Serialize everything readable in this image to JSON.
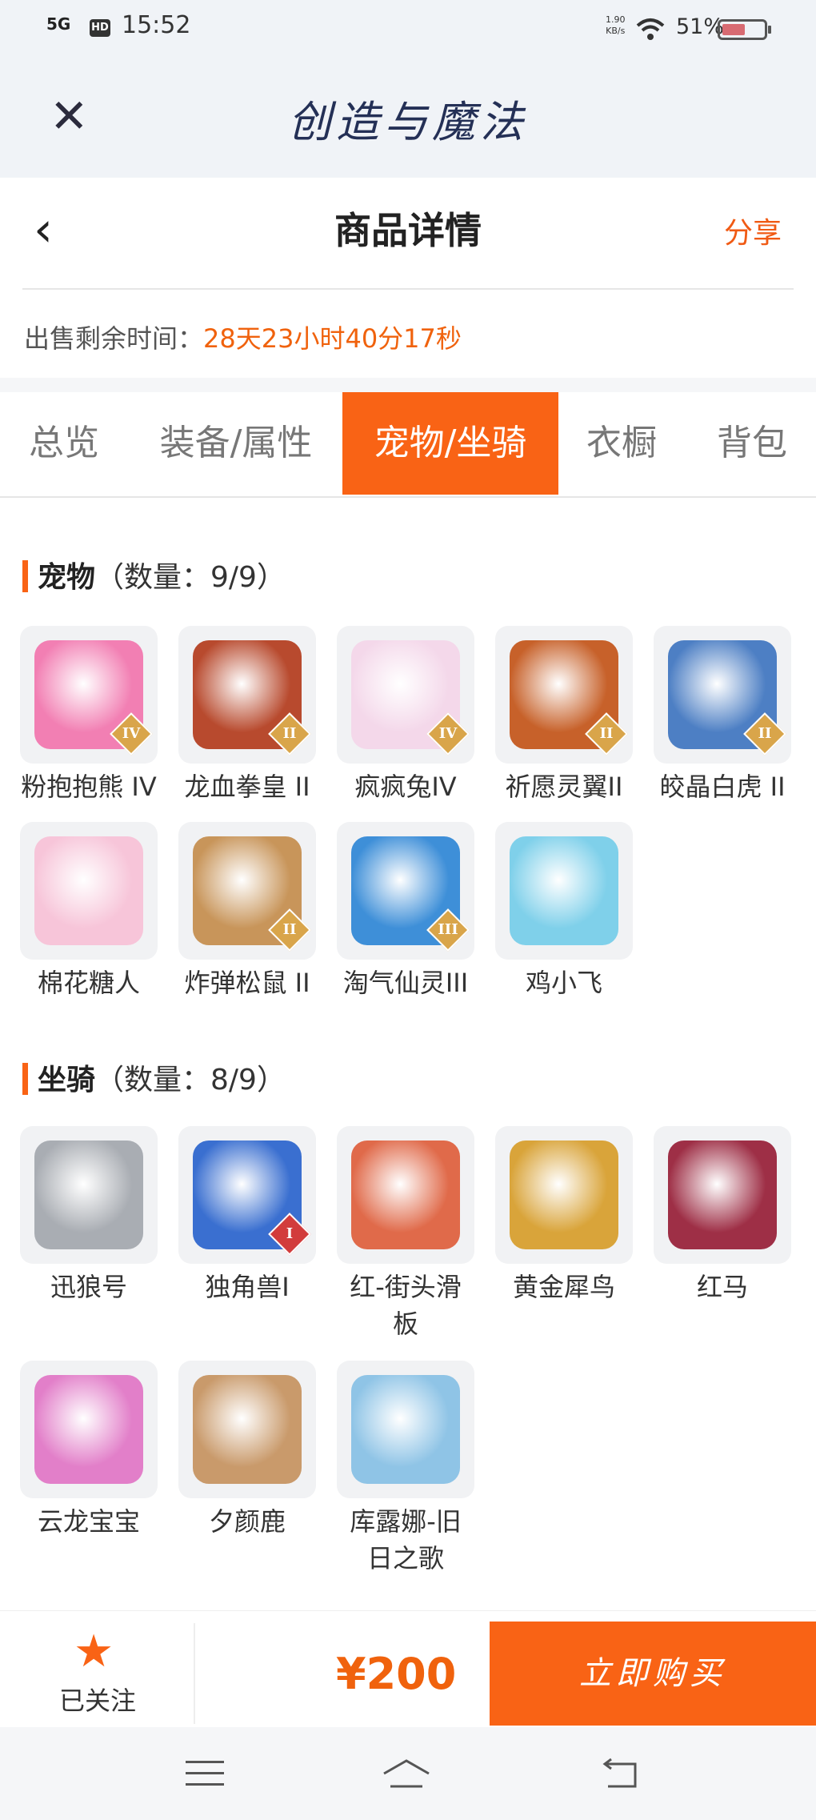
{
  "status_bar": {
    "signal": "5G",
    "hd": "HD",
    "time": "15:52",
    "net_speed": "1.90",
    "net_unit": "KB/s",
    "battery": "51%"
  },
  "app": {
    "title": "创造与魔法"
  },
  "nav": {
    "title": "商品详情",
    "share": "分享"
  },
  "countdown": {
    "label": "出售剩余时间：",
    "value": "28天23小时40分17秒"
  },
  "tabs": [
    {
      "label": "总览",
      "active": false
    },
    {
      "label": "装备/属性",
      "active": false
    },
    {
      "label": "宠物/坐骑",
      "active": true
    },
    {
      "label": "衣橱",
      "active": false
    },
    {
      "label": "背包",
      "active": false
    }
  ],
  "pets": {
    "title": "宠物",
    "count": "（数量：9/9）",
    "items": [
      {
        "name": "粉抱抱熊 IV",
        "tier": "IV",
        "color": "#f27fb3"
      },
      {
        "name": "龙血拳皇 II",
        "tier": "II",
        "color": "#b84a2e"
      },
      {
        "name": "疯疯兔IV",
        "tier": "IV",
        "color": "#f4d8ea"
      },
      {
        "name": "祈愿灵翼II",
        "tier": "II",
        "color": "#c7612a"
      },
      {
        "name": "皎晶白虎 II",
        "tier": "II",
        "color": "#4d7fc4"
      },
      {
        "name": "棉花糖人",
        "tier": "",
        "color": "#f7c5d9"
      },
      {
        "name": "炸弹松鼠 II",
        "tier": "II",
        "color": "#c8955a"
      },
      {
        "name": "淘气仙灵III",
        "tier": "III",
        "color": "#3e8fd8"
      },
      {
        "name": "鸡小飞",
        "tier": "",
        "color": "#7fd0ea"
      }
    ]
  },
  "mounts": {
    "title": "坐骑",
    "count": "（数量：8/9）",
    "items": [
      {
        "name": "迅狼号",
        "tier": "",
        "color": "#a9adb3"
      },
      {
        "name": "独角兽I",
        "tier": "I",
        "color": "#3a6fd0"
      },
      {
        "name": "红-街头滑板",
        "tier": "",
        "color": "#e06a4a"
      },
      {
        "name": "黄金犀鸟",
        "tier": "",
        "color": "#d9a43a"
      },
      {
        "name": "红马",
        "tier": "",
        "color": "#9e2f46"
      },
      {
        "name": "云龙宝宝",
        "tier": "",
        "color": "#e27fc9"
      },
      {
        "name": "夕颜鹿",
        "tier": "",
        "color": "#c99a6b"
      },
      {
        "name": "库露娜-旧日之歌",
        "tier": "",
        "color": "#8fc4e6"
      }
    ]
  },
  "bottom": {
    "follow": "已关注",
    "price": "¥200",
    "buy": "立即购买"
  },
  "accent": "#f96315"
}
